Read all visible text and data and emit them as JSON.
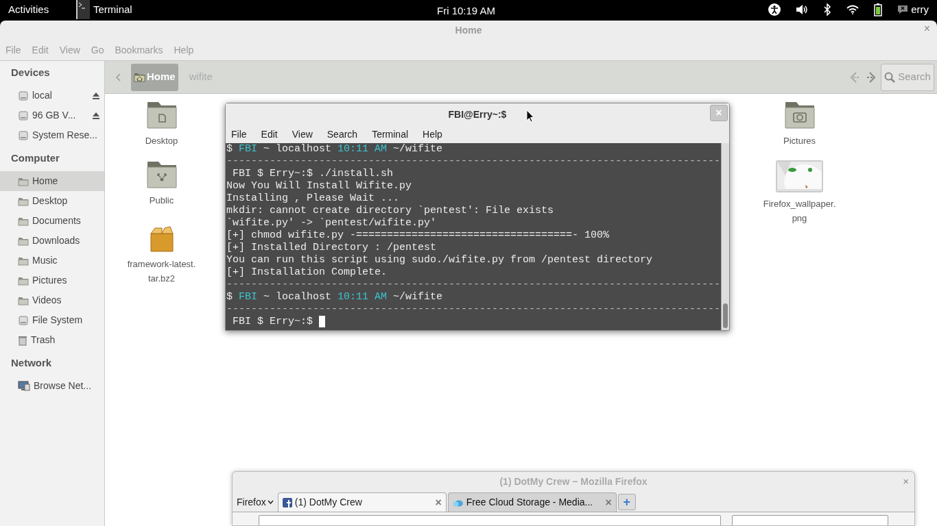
{
  "topbar": {
    "activities": "Activities",
    "app": "Terminal",
    "clock": "Fri 10:19 AM",
    "user": "erry"
  },
  "files_window": {
    "title": "Home",
    "close": "×",
    "menu": [
      "File",
      "Edit",
      "View",
      "Go",
      "Bookmarks",
      "Help"
    ],
    "path": [
      {
        "label": "Home",
        "selected": true
      },
      {
        "label": "wifite",
        "selected": false
      }
    ],
    "search": "Search",
    "sidebar": [
      {
        "heading": "Devices",
        "items": [
          {
            "label": "local",
            "kind": "drive",
            "eject": true,
            "selected": false
          },
          {
            "label": "96 GB V...",
            "kind": "drive",
            "eject": true,
            "selected": false
          },
          {
            "label": "System Rese...",
            "kind": "drive",
            "eject": false,
            "selected": false
          }
        ]
      },
      {
        "heading": "Computer",
        "items": [
          {
            "label": "Home",
            "kind": "folder",
            "eject": false,
            "selected": true
          },
          {
            "label": "Desktop",
            "kind": "folder",
            "eject": false,
            "selected": false
          },
          {
            "label": "Documents",
            "kind": "folder",
            "eject": false,
            "selected": false
          },
          {
            "label": "Downloads",
            "kind": "folder",
            "eject": false,
            "selected": false
          },
          {
            "label": "Music",
            "kind": "folder",
            "eject": false,
            "selected": false
          },
          {
            "label": "Pictures",
            "kind": "folder",
            "eject": false,
            "selected": false
          },
          {
            "label": "Videos",
            "kind": "folder",
            "eject": false,
            "selected": false
          },
          {
            "label": "File System",
            "kind": "drive",
            "eject": false,
            "selected": false
          },
          {
            "label": "Trash",
            "kind": "trash",
            "eject": false,
            "selected": false
          }
        ]
      },
      {
        "heading": "Network",
        "items": [
          {
            "label": "Browse Net...",
            "kind": "network",
            "eject": false,
            "selected": false
          }
        ]
      }
    ],
    "files": [
      {
        "name": "Desktop",
        "kind": "desktop-folder"
      },
      {
        "name": "Pictures",
        "kind": "pictures-folder"
      },
      {
        "name": "Public",
        "kind": "public-folder"
      },
      {
        "name": "Firefox_wallpaper.png",
        "kind": "picture"
      },
      {
        "name": "framework-latest.tar.bz2",
        "kind": "archive"
      }
    ]
  },
  "terminal": {
    "title": "FBI@Erry~:$",
    "close": "×",
    "menu": [
      "File",
      "Edit",
      "View",
      "Search",
      "Terminal",
      "Help"
    ],
    "lines": [
      {
        "kind": "prompt",
        "parts": [
          "$ ",
          "FBI",
          " ~ localhost ",
          "10:11 AM",
          " ~/wifite"
        ]
      },
      {
        "kind": "rule",
        "text": "--------------------------------------------------------------------------------"
      },
      {
        "kind": "output",
        "text": " FBI $ Erry~:$ ./install.sh"
      },
      {
        "kind": "output",
        "text": "Now You Will Install Wifite.py"
      },
      {
        "kind": "output",
        "text": "Installing , Please Wait ..."
      },
      {
        "kind": "output",
        "text": "mkdir: cannot create directory `pentest': File exists"
      },
      {
        "kind": "output",
        "text": "`wifite.py' -> `pentest/wifite.py'"
      },
      {
        "kind": "output",
        "text": "[+] chmod wifite.py -===================================- 100%"
      },
      {
        "kind": "output",
        "text": "[+] Installed Directory : /pentest"
      },
      {
        "kind": "output",
        "text": "You can run this script using sudo./wifite.py from /pentest directory"
      },
      {
        "kind": "output",
        "text": "[+] Installation Complete."
      },
      {
        "kind": "rule",
        "text": "--------------------------------------------------------------------------------"
      },
      {
        "kind": "prompt",
        "parts": [
          "$ ",
          "FBI",
          " ~ localhost ",
          "10:11 AM",
          " ~/wifite"
        ]
      },
      {
        "kind": "rule",
        "text": "--------------------------------------------------------------------------------"
      },
      {
        "kind": "input",
        "text": " FBI $ Erry~:$ ",
        "cursor": true
      }
    ]
  },
  "firefox": {
    "title": "(1) DotMy Crew − Mozilla Firefox",
    "close": "×",
    "menu_button": "Firefox",
    "tabs": [
      {
        "label": "(1) DotMy Crew",
        "selected": true,
        "close": "×"
      },
      {
        "label": "Free Cloud Storage - Media...",
        "selected": false,
        "close": "×"
      }
    ],
    "new_tab": "+"
  }
}
